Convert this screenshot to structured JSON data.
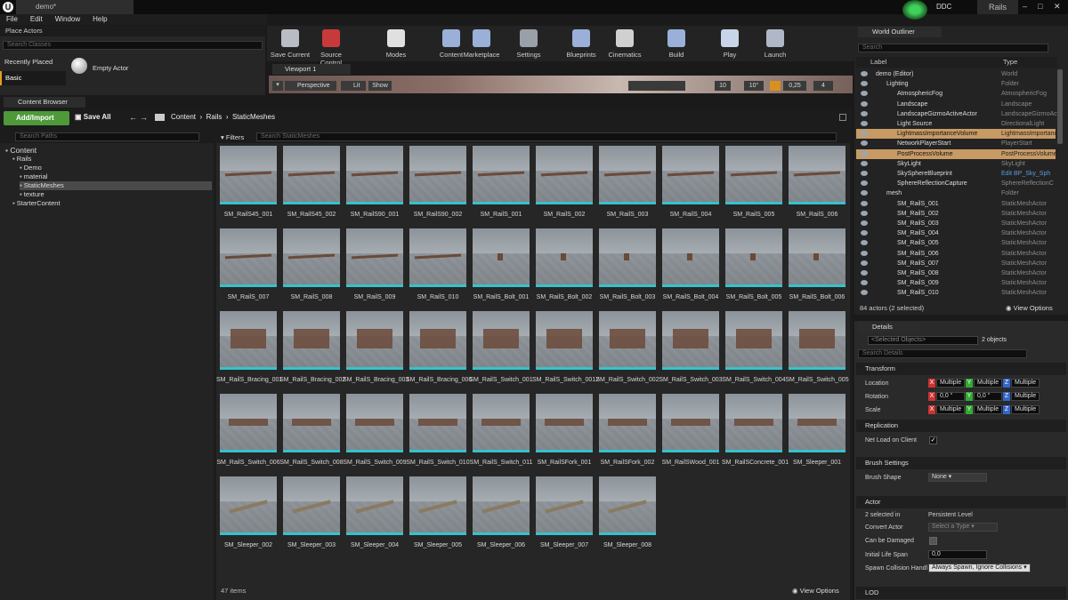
{
  "tab_title": "demo*",
  "ddc": "DDC",
  "project": "Rails",
  "menu": [
    "File",
    "Edit",
    "Window",
    "Help"
  ],
  "place": {
    "title": "Place Actors",
    "search_placeholder": "Search Classes",
    "recently": "Recently Placed",
    "basic": "Basic",
    "empty_actor": "Empty Actor"
  },
  "toolbar": [
    {
      "label": "Save Current",
      "icon": "save-icon",
      "color": "#b8bcc4"
    },
    {
      "label": "Source Control",
      "icon": "source-control-icon",
      "color": "#c63a3a"
    },
    {
      "label": "Modes",
      "icon": "modes-icon",
      "color": "#e0e0e0"
    },
    {
      "label": "Content",
      "icon": "content-icon",
      "color": "#9ab0d8"
    },
    {
      "label": "Marketplace",
      "icon": "marketplace-icon",
      "color": "#9ab0d8"
    },
    {
      "label": "Settings",
      "icon": "settings-icon",
      "color": "#9aa0aa"
    },
    {
      "label": "Blueprints",
      "icon": "blueprints-icon",
      "color": "#9ab0d8"
    },
    {
      "label": "Cinematics",
      "icon": "cinematics-icon",
      "color": "#d0d0d0"
    },
    {
      "label": "Build",
      "icon": "build-icon",
      "color": "#9ab0d8"
    },
    {
      "label": "Play",
      "icon": "play-icon",
      "color": "#c8d4e8"
    },
    {
      "label": "Launch",
      "icon": "launch-icon",
      "color": "#b0b8c8"
    }
  ],
  "viewport": {
    "tab": "Viewport 1",
    "perspective": "Perspective",
    "lit": "Lit",
    "show": "Show",
    "grid": "10",
    "angle": "10°",
    "scale": "0,25",
    "cam": "4"
  },
  "cb": {
    "title": "Content Browser",
    "add": "Add/Import",
    "save_all": "Save All",
    "path": [
      "Content",
      "Rails",
      "StaticMeshes"
    ],
    "search_paths": "Search Paths",
    "filters": "Filters",
    "search_assets": "Search StaticMeshes",
    "items_count": "47 items",
    "view_options": "View Options"
  },
  "tree": [
    {
      "label": "Content",
      "indent": 0
    },
    {
      "label": "Rails",
      "indent": 1
    },
    {
      "label": "Demo",
      "indent": 2
    },
    {
      "label": "material",
      "indent": 2
    },
    {
      "label": "StaticMeshes",
      "indent": 2
    },
    {
      "label": "texture",
      "indent": 2
    },
    {
      "label": "StarterContent",
      "indent": 1
    }
  ],
  "assets": [
    "SM_RailS45_001",
    "SM_RailS45_002",
    "SM_RailS90_001",
    "SM_RailS90_002",
    "SM_RailS_001",
    "SM_RailS_002",
    "SM_RailS_003",
    "SM_RailS_004",
    "SM_RailS_005",
    "SM_RailS_006",
    "SM_RailS_007",
    "SM_RailS_008",
    "SM_RailS_009",
    "SM_RailS_010",
    "SM_RailS_Bolt_001",
    "SM_RailS_Bolt_002",
    "SM_RailS_Bolt_003",
    "SM_RailS_Bolt_004",
    "SM_RailS_Bolt_005",
    "SM_RailS_Bolt_006",
    "SM_RailS_Bracing_001",
    "SM_RailS_Bracing_002",
    "SM_RailS_Bracing_003",
    "SM_RailS_Bracing_006",
    "SM_RailS_Switch_001",
    "SM_RailS_Switch_0012",
    "SM_RailS_Switch_002",
    "SM_RailS_Switch_003",
    "SM_RailS_Switch_004",
    "SM_RailS_Switch_005",
    "SM_RailS_Switch_006",
    "SM_RailS_Switch_008",
    "SM_RailS_Switch_009",
    "SM_RailS_Switch_010",
    "SM_RailS_Switch_011",
    "SM_RailSFork_001",
    "SM_RailSFork_002",
    "SM_RailSWood_001",
    "SM_RailSConcrete_001",
    "SM_Sleeper_001",
    "SM_Sleeper_002",
    "SM_Sleeper_003",
    "SM_Sleeper_004",
    "SM_Sleeper_005",
    "SM_Sleeper_006",
    "SM_Sleeper_007",
    "SM_Sleeper_008"
  ],
  "outliner": {
    "title": "World Outliner",
    "search": "Search",
    "col_label": "Label",
    "col_type": "Type",
    "count": "84 actors (2 selected)",
    "view_options": "View Options",
    "rows": [
      {
        "label": "demo (Editor)",
        "type": "World",
        "indent": 0,
        "sel": false
      },
      {
        "label": "Lighting",
        "type": "Folder",
        "indent": 1,
        "sel": false
      },
      {
        "label": "AtmosphericFog",
        "type": "AtmosphericFog",
        "indent": 2,
        "sel": false
      },
      {
        "label": "Landscape",
        "type": "Landscape",
        "indent": 2,
        "sel": false
      },
      {
        "label": "LandscapeGizmoActiveActor",
        "type": "LandscapeGizmoActi",
        "indent": 2,
        "sel": false
      },
      {
        "label": "Light Source",
        "type": "DirectionalLight",
        "indent": 2,
        "sel": false
      },
      {
        "label": "LightmassImportanceVolume",
        "type": "LightmassImportanc",
        "indent": 2,
        "sel": true
      },
      {
        "label": "NetworkPlayerStart",
        "type": "PlayerStart",
        "indent": 2,
        "sel": false
      },
      {
        "label": "PostProcessVolume",
        "type": "PostProcessVolume",
        "indent": 2,
        "sel": true
      },
      {
        "label": "SkyLight",
        "type": "SkyLight",
        "indent": 2,
        "sel": false
      },
      {
        "label": "SkySphereBlueprint",
        "type": "Edit BP_Sky_Sph",
        "indent": 2,
        "sel": false
      },
      {
        "label": "SphereReflectionCapture",
        "type": "SphereReflectionC",
        "indent": 2,
        "sel": false
      },
      {
        "label": "mesh",
        "type": "Folder",
        "indent": 1,
        "sel": false
      },
      {
        "label": "SM_RailS_001",
        "type": "StaticMeshActor",
        "indent": 2,
        "sel": false
      },
      {
        "label": "SM_RailS_002",
        "type": "StaticMeshActor",
        "indent": 2,
        "sel": false
      },
      {
        "label": "SM_RailS_003",
        "type": "StaticMeshActor",
        "indent": 2,
        "sel": false
      },
      {
        "label": "SM_RailS_004",
        "type": "StaticMeshActor",
        "indent": 2,
        "sel": false
      },
      {
        "label": "SM_RailS_005",
        "type": "StaticMeshActor",
        "indent": 2,
        "sel": false
      },
      {
        "label": "SM_RailS_006",
        "type": "StaticMeshActor",
        "indent": 2,
        "sel": false
      },
      {
        "label": "SM_RailS_007",
        "type": "StaticMeshActor",
        "indent": 2,
        "sel": false
      },
      {
        "label": "SM_RailS_008",
        "type": "StaticMeshActor",
        "indent": 2,
        "sel": false
      },
      {
        "label": "SM_RailS_009",
        "type": "StaticMeshActor",
        "indent": 2,
        "sel": false
      },
      {
        "label": "SM_RailS_010",
        "type": "StaticMeshActor",
        "indent": 2,
        "sel": false
      }
    ]
  },
  "details": {
    "title": "Details",
    "selected": "<Selected Objects>",
    "count": "2 objects",
    "search": "Search Details",
    "transform": "Transform",
    "location": "Location",
    "rotation": "Rotation",
    "scale": "Scale",
    "multiple": "Multiple",
    "zero": "0,0 °",
    "replication": "Replication",
    "net_load": "Net Load on Client",
    "brush": "Brush Settings",
    "brush_shape": "Brush Shape",
    "none": "None",
    "actor": "Actor",
    "selected_in": "2 selected in",
    "persistent": "Persistent Level",
    "convert": "Convert Actor",
    "select_type": "Select a Type",
    "can_damage": "Can be Damaged",
    "life_span": "Initial Life Span",
    "life_val": "0,0",
    "spawn": "Spawn Collision Handl",
    "spawn_val": "Always Spawn, Ignore Collisions",
    "lod": "LOD"
  }
}
